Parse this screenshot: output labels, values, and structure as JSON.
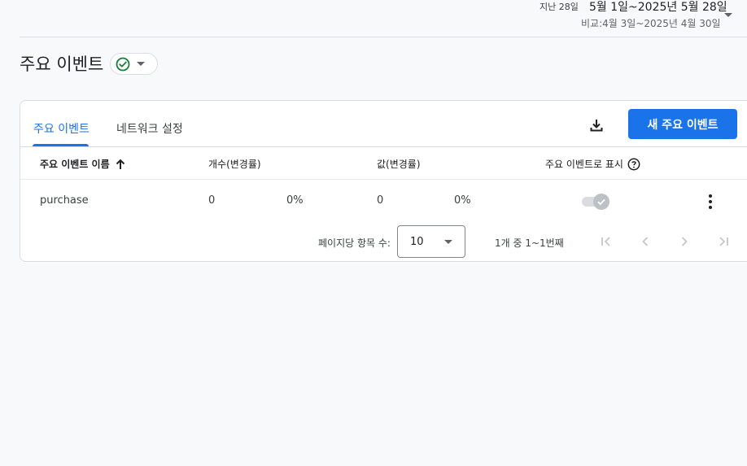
{
  "date_range": {
    "period": "지난 28일",
    "range": "5월 1일~2025년 5월 28일",
    "compare": "비교:4월 3일~2025년 4월 30일"
  },
  "page": {
    "title": "주요 이벤트"
  },
  "tabs": [
    {
      "label": "주요 이벤트",
      "active": true
    },
    {
      "label": "네트워크 설정",
      "active": false
    }
  ],
  "toolbar": {
    "new_button_label": "새 주요 이벤트"
  },
  "table": {
    "columns": {
      "name": "주요 이벤트 이름",
      "count": "개수(변경률)",
      "value": "값(변경률)",
      "mark_as_key": "주요 이벤트로 표시"
    },
    "rows": [
      {
        "name": "purchase",
        "count": "0",
        "count_change": "0%",
        "value": "0",
        "value_change": "0%",
        "marked": true
      }
    ]
  },
  "pagination": {
    "per_page_label": "페이지당 항목 수:",
    "per_page_value": "10",
    "range_text": "1개 중 1~1번째"
  },
  "colors": {
    "accent": "#1a73e8",
    "success": "#188038"
  }
}
